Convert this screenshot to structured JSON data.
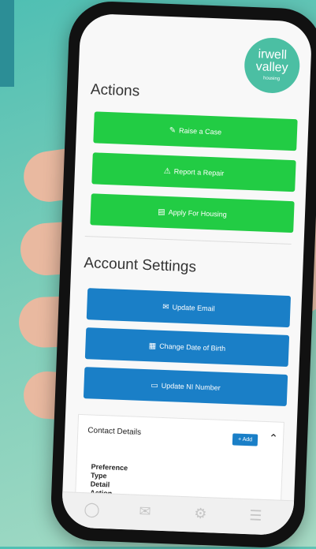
{
  "logo": {
    "line1": "irwell",
    "line2": "valley",
    "line3": "housing"
  },
  "actions": {
    "title": "Actions",
    "buttons": [
      {
        "icon": "✎",
        "label": "Raise a Case"
      },
      {
        "icon": "⚠",
        "label": "Report a Repair"
      },
      {
        "icon": "▤",
        "label": "Apply For Housing"
      }
    ]
  },
  "account": {
    "title": "Account Settings",
    "buttons": [
      {
        "icon": "✉",
        "label": "Update Email"
      },
      {
        "icon": "▦",
        "label": "Change Date of Birth"
      },
      {
        "icon": "▭",
        "label": "Update NI Number"
      }
    ]
  },
  "contact": {
    "title": "Contact Details",
    "add_label": "+ Add",
    "chevron": "⌃",
    "fields": [
      "Preference",
      "Type",
      "Detail",
      "Action"
    ]
  },
  "tabbar": {
    "icons": [
      "home-icon",
      "mail-icon",
      "settings-icon",
      "menu-icon"
    ],
    "glyphs": [
      "◯",
      "✉",
      "⚙",
      "☰"
    ]
  },
  "colors": {
    "green": "#22cc44",
    "blue": "#1a7fc7",
    "brand": "#4bbfa3"
  }
}
